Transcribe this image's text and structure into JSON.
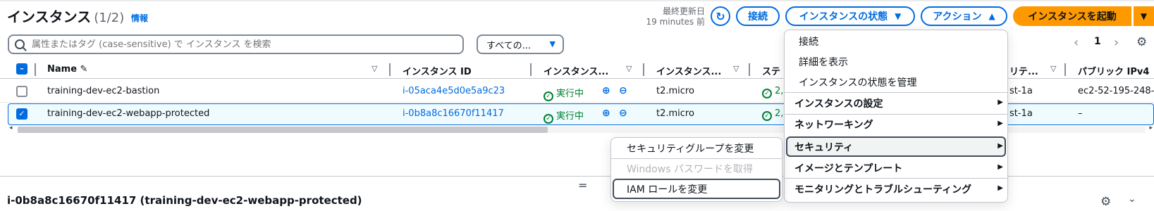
{
  "header": {
    "title": "インスタンス",
    "count": "(1/2)",
    "info_link": "情報",
    "last_updated_label": "最終更新日",
    "last_updated_value": "19 minutes 前",
    "connect_label": "接続",
    "instance_state_label": "インスタンスの状態",
    "actions_label": "アクション",
    "launch_label": "インスタンスを起動"
  },
  "filter": {
    "search_placeholder": "属性またはタグ (case-sensitive) で インスタンス を検索",
    "state_select_value": "すべての..."
  },
  "pagination": {
    "current_page": "1"
  },
  "table": {
    "columns": [
      "Name",
      "インスタンス ID",
      "インスタンス...",
      "インスタンス...",
      "ステ",
      "リテ...",
      "パブリック IPv4"
    ],
    "rows": [
      {
        "selected": false,
        "name": "training-dev-ec2-bastion",
        "instance_id": "i-05aca4e5d0e5a9c23",
        "state": "実行中",
        "type": "t2.micro",
        "status": "2,",
        "az": "st-1a",
        "public_ipv4": "ec2-52-195-248-"
      },
      {
        "selected": true,
        "name": "training-dev-ec2-webapp-protected",
        "instance_id": "i-0b8a8c16670f11417",
        "state": "実行中",
        "type": "t2.micro",
        "status": "2,",
        "az": "st-1a",
        "public_ipv4": "–"
      }
    ]
  },
  "detail": {
    "title": "i-0b8a8c16670f11417 (training-dev-ec2-webapp-protected)"
  },
  "actions_menu": {
    "items": [
      "接続",
      "詳細を表示",
      "インスタンスの状態を管理"
    ],
    "groups": [
      "インスタンスの設定",
      "ネットワーキング",
      "セキュリティ",
      "イメージとテンプレート",
      "モニタリングとトラブルシューティング"
    ],
    "highlighted_group": "セキュリティ"
  },
  "security_submenu": {
    "items": [
      "セキュリティグループを変更",
      "Windows パスワードを取得",
      "IAM ロールを変更"
    ],
    "disabled_item": "Windows パスワードを取得",
    "highlighted_item": "IAM ロールを変更"
  },
  "colors": {
    "accent": "#006ce0",
    "launch_button": "#ff9900",
    "running_status": "#00802f"
  }
}
